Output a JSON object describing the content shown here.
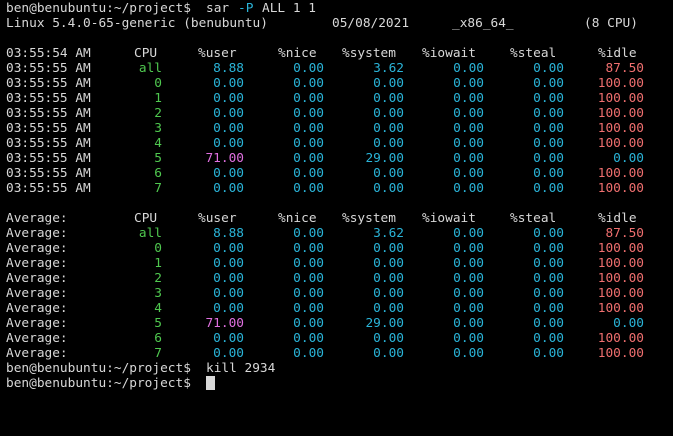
{
  "terminal": {
    "prompt": "ben@benubuntu:~/project$",
    "command1": {
      "cmd": "sar",
      "arg_opt": "-P",
      "arg_rest": "ALL 1 1"
    },
    "sysinfo": {
      "kernel": "Linux 5.4.0-65-generic (benubuntu)",
      "date": "05/08/2021",
      "arch": "_x86_64_",
      "cpus": "(8 CPU)"
    },
    "header": {
      "time": "03:55:54 AM",
      "cpu": "CPU",
      "user": "%user",
      "nice": "%nice",
      "system": "%system",
      "iowait": "%iowait",
      "steal": "%steal",
      "idle": "%idle"
    },
    "rows": [
      {
        "time": "03:55:55 AM",
        "cpu": "all",
        "user": "8.88",
        "nice": "0.00",
        "system": "3.62",
        "iowait": "0.00",
        "steal": "0.00",
        "idle": "87.50"
      },
      {
        "time": "03:55:55 AM",
        "cpu": "0",
        "user": "0.00",
        "nice": "0.00",
        "system": "0.00",
        "iowait": "0.00",
        "steal": "0.00",
        "idle": "100.00"
      },
      {
        "time": "03:55:55 AM",
        "cpu": "1",
        "user": "0.00",
        "nice": "0.00",
        "system": "0.00",
        "iowait": "0.00",
        "steal": "0.00",
        "idle": "100.00"
      },
      {
        "time": "03:55:55 AM",
        "cpu": "2",
        "user": "0.00",
        "nice": "0.00",
        "system": "0.00",
        "iowait": "0.00",
        "steal": "0.00",
        "idle": "100.00"
      },
      {
        "time": "03:55:55 AM",
        "cpu": "3",
        "user": "0.00",
        "nice": "0.00",
        "system": "0.00",
        "iowait": "0.00",
        "steal": "0.00",
        "idle": "100.00"
      },
      {
        "time": "03:55:55 AM",
        "cpu": "4",
        "user": "0.00",
        "nice": "0.00",
        "system": "0.00",
        "iowait": "0.00",
        "steal": "0.00",
        "idle": "100.00"
      },
      {
        "time": "03:55:55 AM",
        "cpu": "5",
        "user": "71.00",
        "nice": "0.00",
        "system": "29.00",
        "iowait": "0.00",
        "steal": "0.00",
        "idle": "0.00"
      },
      {
        "time": "03:55:55 AM",
        "cpu": "6",
        "user": "0.00",
        "nice": "0.00",
        "system": "0.00",
        "iowait": "0.00",
        "steal": "0.00",
        "idle": "100.00"
      },
      {
        "time": "03:55:55 AM",
        "cpu": "7",
        "user": "0.00",
        "nice": "0.00",
        "system": "0.00",
        "iowait": "0.00",
        "steal": "0.00",
        "idle": "100.00"
      }
    ],
    "avg_header": {
      "time": "Average:",
      "cpu": "CPU",
      "user": "%user",
      "nice": "%nice",
      "system": "%system",
      "iowait": "%iowait",
      "steal": "%steal",
      "idle": "%idle"
    },
    "avg_rows": [
      {
        "time": "Average:",
        "cpu": "all",
        "user": "8.88",
        "nice": "0.00",
        "system": "3.62",
        "iowait": "0.00",
        "steal": "0.00",
        "idle": "87.50"
      },
      {
        "time": "Average:",
        "cpu": "0",
        "user": "0.00",
        "nice": "0.00",
        "system": "0.00",
        "iowait": "0.00",
        "steal": "0.00",
        "idle": "100.00"
      },
      {
        "time": "Average:",
        "cpu": "1",
        "user": "0.00",
        "nice": "0.00",
        "system": "0.00",
        "iowait": "0.00",
        "steal": "0.00",
        "idle": "100.00"
      },
      {
        "time": "Average:",
        "cpu": "2",
        "user": "0.00",
        "nice": "0.00",
        "system": "0.00",
        "iowait": "0.00",
        "steal": "0.00",
        "idle": "100.00"
      },
      {
        "time": "Average:",
        "cpu": "3",
        "user": "0.00",
        "nice": "0.00",
        "system": "0.00",
        "iowait": "0.00",
        "steal": "0.00",
        "idle": "100.00"
      },
      {
        "time": "Average:",
        "cpu": "4",
        "user": "0.00",
        "nice": "0.00",
        "system": "0.00",
        "iowait": "0.00",
        "steal": "0.00",
        "idle": "100.00"
      },
      {
        "time": "Average:",
        "cpu": "5",
        "user": "71.00",
        "nice": "0.00",
        "system": "29.00",
        "iowait": "0.00",
        "steal": "0.00",
        "idle": "0.00"
      },
      {
        "time": "Average:",
        "cpu": "6",
        "user": "0.00",
        "nice": "0.00",
        "system": "0.00",
        "iowait": "0.00",
        "steal": "0.00",
        "idle": "100.00"
      },
      {
        "time": "Average:",
        "cpu": "7",
        "user": "0.00",
        "nice": "0.00",
        "system": "0.00",
        "iowait": "0.00",
        "steal": "0.00",
        "idle": "100.00"
      }
    ],
    "command2": "kill 2934",
    "colors": {
      "background": "#000000",
      "text": "#d8d8d8",
      "cpu_id": "#4fc84f",
      "number": "#2ab4d8",
      "user_high": "#e070e0",
      "idle_high": "#ef6f6f"
    }
  }
}
